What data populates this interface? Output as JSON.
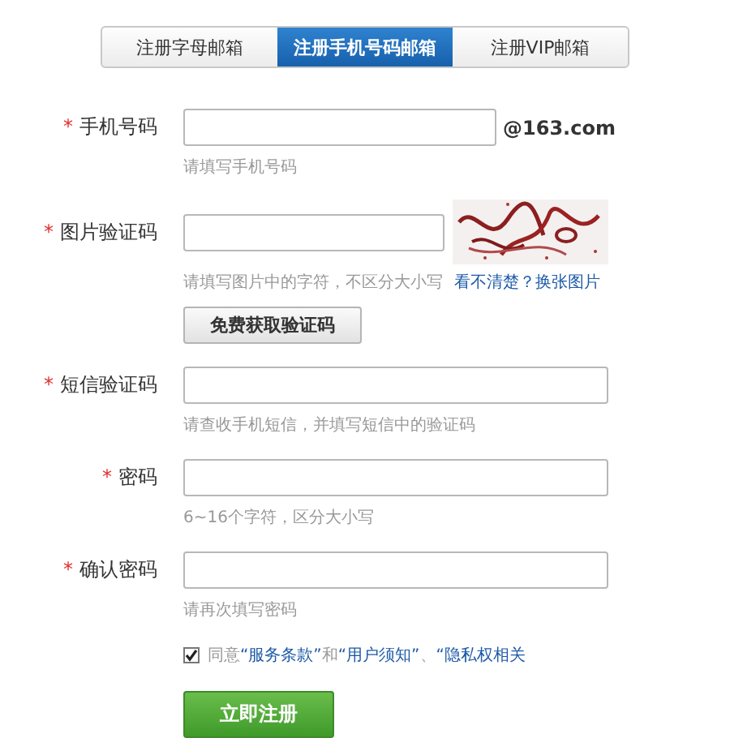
{
  "tabs": [
    {
      "label": "注册字母邮箱",
      "selected": false
    },
    {
      "label": "注册手机号码邮箱",
      "selected": true
    },
    {
      "label": "注册VIP邮箱",
      "selected": false
    }
  ],
  "fields": [
    {
      "kind": "phone",
      "required_mark": "*",
      "label": "手机号码",
      "suffix": "@163.com",
      "hint": "请填写手机号码"
    },
    {
      "kind": "captcha",
      "required_mark": "*",
      "label": "图片验证码",
      "hint": "请填写图片中的字符，不区分大小写",
      "refresh_link": "看不清楚？换张图片",
      "button": "免费获取验证码"
    },
    {
      "kind": "text",
      "required_mark": "*",
      "label": "短信验证码",
      "hint": "请查收手机短信，并填写短信中的验证码"
    },
    {
      "kind": "password",
      "required_mark": "*",
      "label": "密码",
      "hint": "6~16个字符，区分大小写"
    },
    {
      "kind": "password",
      "required_mark": "*",
      "label": "确认密码",
      "hint": "请再次填写密码"
    }
  ],
  "agreement": {
    "checked": true,
    "parts": [
      {
        "kind": "text",
        "text": "同意"
      },
      {
        "kind": "link",
        "text": "“服务条款”"
      },
      {
        "kind": "text",
        "text": "和"
      },
      {
        "kind": "link",
        "text": "“用户须知”"
      },
      {
        "kind": "text",
        "text": "、"
      },
      {
        "kind": "link",
        "text": "“隐私权相关"
      }
    ]
  },
  "submit": "立即注册"
}
